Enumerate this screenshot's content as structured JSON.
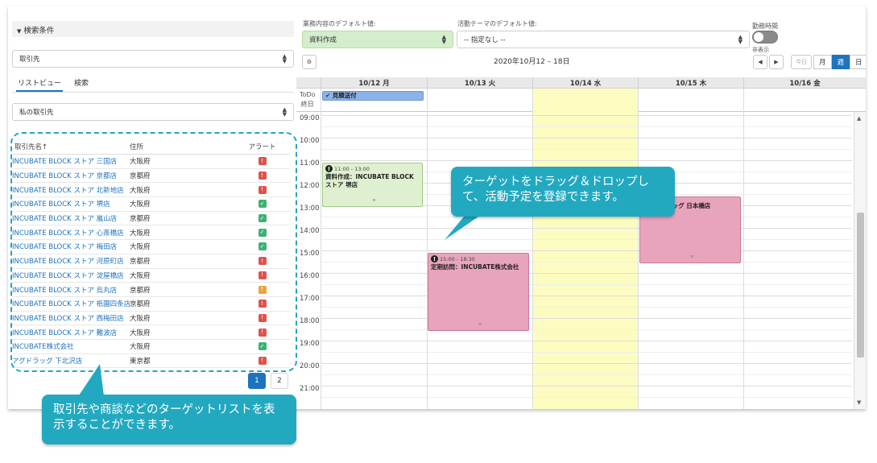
{
  "search": {
    "header": "検索条件",
    "object_select": "取引先",
    "tabs": [
      {
        "label": "リストビュー",
        "active": true
      },
      {
        "label": "検索",
        "active": false
      }
    ],
    "view_select": "私の取引先"
  },
  "table": {
    "headers": {
      "name": "取引先名",
      "sort_icon": "↑",
      "address": "住所",
      "alert": "アラート"
    },
    "rows": [
      {
        "name": "INCUBATE BLOCK ストア 三国店",
        "address": "大阪府",
        "alert": "warning-red"
      },
      {
        "name": "INCUBATE BLOCK ストア 京都店",
        "address": "京都府",
        "alert": "warning-red"
      },
      {
        "name": "INCUBATE BLOCK ストア 北新地店",
        "address": "大阪府",
        "alert": "warning-red"
      },
      {
        "name": "INCUBATE BLOCK ストア 堺店",
        "address": "大阪府",
        "alert": "check-green"
      },
      {
        "name": "INCUBATE BLOCK ストア 嵐山店",
        "address": "京都府",
        "alert": "check-green"
      },
      {
        "name": "INCUBATE BLOCK ストア 心斎橋店",
        "address": "大阪府",
        "alert": "check-green"
      },
      {
        "name": "INCUBATE BLOCK ストア 梅田店",
        "address": "大阪府",
        "alert": "check-green"
      },
      {
        "name": "INCUBATE BLOCK ストア 河原町店",
        "address": "京都府",
        "alert": "warning-red"
      },
      {
        "name": "INCUBATE BLOCK ストア 淀屋橋店",
        "address": "大阪府",
        "alert": "warning-red"
      },
      {
        "name": "INCUBATE BLOCK ストア 烏丸店",
        "address": "京都府",
        "alert": "warning-orange"
      },
      {
        "name": "INCUBATE BLOCK ストア 祇園四条店",
        "address": "京都府",
        "alert": "warning-red"
      },
      {
        "name": "INCUBATE BLOCK ストア 西梅田店",
        "address": "大阪府",
        "alert": "warning-red"
      },
      {
        "name": "INCUBATE BLOCK ストア 難波店",
        "address": "大阪府",
        "alert": "warning-red"
      },
      {
        "name": "INCUBATE株式会社",
        "address": "大阪府",
        "alert": "check-green"
      },
      {
        "name": "アグドラッグ 下北沢店",
        "address": "東京都",
        "alert": "warning-red"
      }
    ]
  },
  "pager": {
    "pages": [
      "1",
      "2"
    ],
    "current": "1"
  },
  "settings": {
    "task_default_label": "業務内容のデフォルト値:",
    "task_default_value": "資料作成",
    "theme_default_label": "活動テーマのデフォルト値:",
    "theme_default_value": "-- 指定なし --",
    "work_hours_label": "勤務時間",
    "work_hours_state": "非表示"
  },
  "calendar": {
    "gear_icon": "gear-icon",
    "date_range": "2020年10月12 – 18日",
    "nav_prev": "◀",
    "nav_next": "▶",
    "today": "今日",
    "views": [
      {
        "label": "月",
        "active": false
      },
      {
        "label": "週",
        "active": true
      },
      {
        "label": "日",
        "active": false
      }
    ],
    "days": [
      "10/12 月",
      "10/13 火",
      "10/14 水",
      "10/15 木",
      "10/16 金"
    ],
    "todo_label": "ToDo",
    "allday_label": "終日",
    "todo_item": "見積送付",
    "hours": [
      "09:00",
      "10:00",
      "11:00",
      "12:00",
      "13:00",
      "14:00",
      "15:00",
      "16:00",
      "17:00",
      "18:00",
      "19:00",
      "20:00",
      "21:00"
    ],
    "events": [
      {
        "time": "11:00 - 13:00",
        "title": "資料作成：INCUBATE BLOCK ストア 堺店",
        "color": "#dff0d0",
        "border": "#9ccc85"
      },
      {
        "time": "15:00 - 18:30",
        "title": "定期訪問：INCUBATE株式会社",
        "color": "#e9a4bd",
        "border": "#c77996"
      },
      {
        "time": "",
        "title": "アグドラッグ 日本橋店",
        "color": "#e9a4bd",
        "border": "#c77996"
      }
    ]
  },
  "callouts": {
    "drag_drop": "ターゲットをドラッグ＆ドロップして、活動予定を登録できます。",
    "target_list": "取引先や商談などのターゲットリストを表示することができます。"
  },
  "colors": {
    "accent": "#1e73be",
    "callout": "#22a9c0",
    "highlight_day": "#fdfcc0",
    "alert_red": "#e0524d",
    "alert_orange": "#f0a23a",
    "alert_green": "#3cb371"
  }
}
